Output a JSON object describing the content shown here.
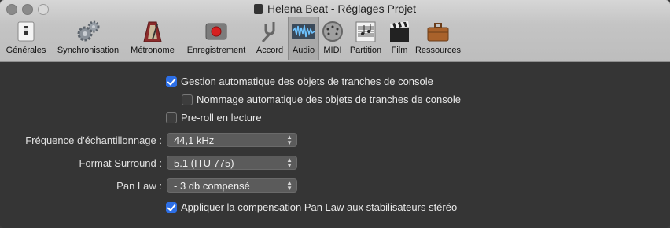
{
  "window": {
    "title": "Helena Beat - Réglages Projet"
  },
  "toolbar": {
    "items": [
      {
        "label": "Générales",
        "icon": "switch-icon"
      },
      {
        "label": "Synchronisation",
        "icon": "gears-icon"
      },
      {
        "label": "Métronome",
        "icon": "metronome-icon"
      },
      {
        "label": "Enregistrement",
        "icon": "record-icon"
      },
      {
        "label": "Accord",
        "icon": "tuning-fork-icon"
      },
      {
        "label": "Audio",
        "icon": "audio-waveform-icon",
        "selected": true
      },
      {
        "label": "MIDI",
        "icon": "midi-connector-icon"
      },
      {
        "label": "Partition",
        "icon": "score-icon"
      },
      {
        "label": "Film",
        "icon": "clapperboard-icon"
      },
      {
        "label": "Ressources",
        "icon": "briefcase-icon"
      }
    ]
  },
  "settings": {
    "auto_channel_strip": {
      "label": "Gestion automatique des objets de tranches de console",
      "checked": true
    },
    "auto_naming": {
      "label": "Nommage automatique des objets de tranches de console",
      "checked": false
    },
    "preroll": {
      "label": "Pre-roll en lecture",
      "checked": false
    },
    "sample_rate": {
      "label": "Fréquence d'échantillonnage :",
      "value": "44,1 kHz"
    },
    "surround": {
      "label": "Format Surround :",
      "value": "5.1 (ITU 775)"
    },
    "pan_law": {
      "label": "Pan Law :",
      "value": "- 3 db compensé"
    },
    "pan_law_stereo": {
      "label": "Appliquer la compensation Pan Law aux stabilisateurs stéréo",
      "checked": true
    }
  },
  "colors": {
    "accent": "#2d6fe6",
    "background": "#353535",
    "titlebar": "#c8c8c8"
  }
}
